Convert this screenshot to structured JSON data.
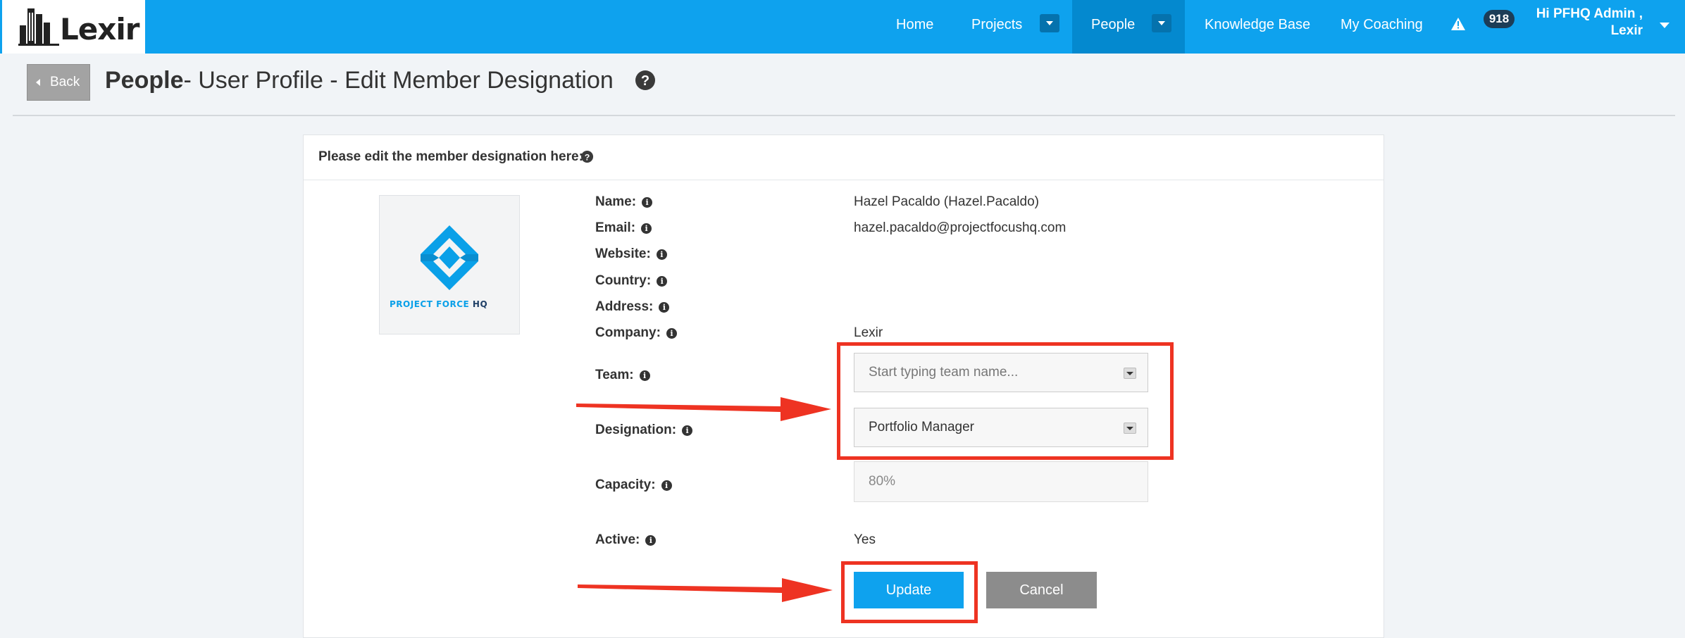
{
  "app": {
    "logo_text": "Lexir"
  },
  "nav": {
    "items": [
      {
        "label": "Home"
      },
      {
        "label": "Projects"
      },
      {
        "label": "People"
      },
      {
        "label": "Knowledge Base"
      },
      {
        "label": "My Coaching"
      }
    ],
    "notification_count": "918",
    "user_greeting_line1": "Hi PFHQ Admin ,",
    "user_greeting_line2": "Lexir"
  },
  "header": {
    "back_label": "Back",
    "title_bold": "People",
    "title_rest": "- User Profile - Edit Member Designation"
  },
  "panel": {
    "heading": "Please edit the member designation here:",
    "avatar_caption_main": "PROJECT FORCE",
    "avatar_caption_accent": "HQ",
    "fields": {
      "name_label": "Name:",
      "name_value": "Hazel Pacaldo (Hazel.Pacaldo)",
      "email_label": "Email:",
      "email_value": "hazel.pacaldo@projectfocushq.com",
      "website_label": "Website:",
      "country_label": "Country:",
      "address_label": "Address:",
      "company_label": "Company:",
      "company_value": "Lexir",
      "team_label": "Team:",
      "team_placeholder": "Start typing team name...",
      "designation_label": "Designation:",
      "designation_value": "Portfolio Manager",
      "capacity_label": "Capacity:",
      "capacity_value": "80%",
      "active_label": "Active:",
      "active_value": "Yes"
    },
    "update_label": "Update",
    "cancel_label": "Cancel"
  },
  "colors": {
    "brand": "#0ea2ee",
    "nav_active": "#0489cf",
    "annotation_red": "#ee3322"
  }
}
